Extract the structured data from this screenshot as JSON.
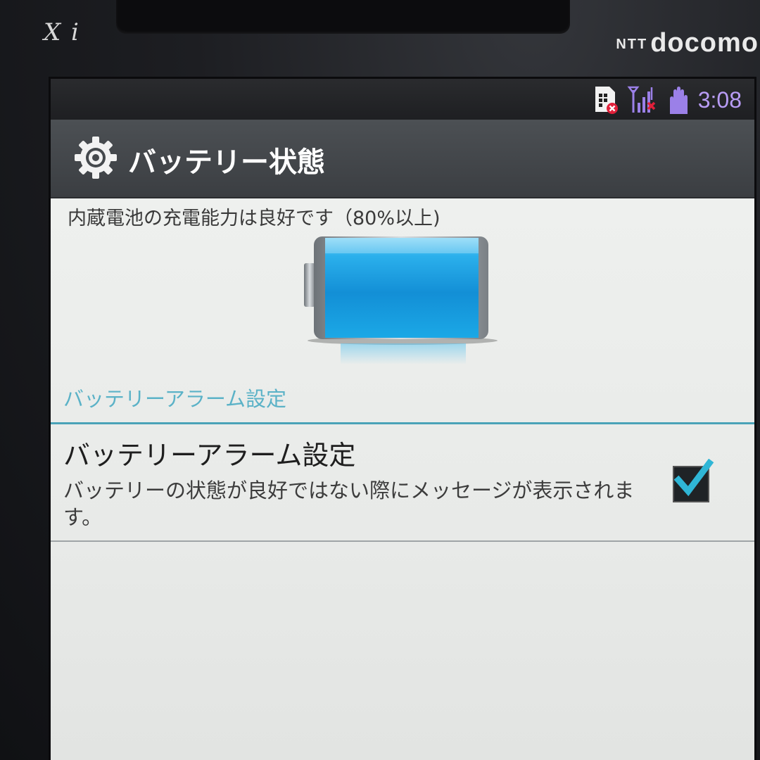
{
  "device": {
    "brand_logo_text": "X i",
    "carrier_prefix": "NTT",
    "carrier_name": "docomo"
  },
  "status_bar": {
    "time": "3:08",
    "icons": [
      "sim-error-icon",
      "signal-no-service-icon",
      "hand-icon"
    ],
    "time_color": "#b89cf5"
  },
  "title_bar": {
    "icon": "gear-icon",
    "title": "バッテリー状態"
  },
  "battery": {
    "health_message": "内蔵電池の充電能力は良好です（80%以上)",
    "icon": "battery-icon",
    "color": "#1a9fe0"
  },
  "section": {
    "header": "バッテリーアラーム設定",
    "accent_color": "#4aa3b8"
  },
  "setting": {
    "title": "バッテリーアラーム設定",
    "description": "バッテリーの状態が良好ではない際にメッセージが表示されます。",
    "checked": true,
    "check_color": "#2fb6d6"
  }
}
